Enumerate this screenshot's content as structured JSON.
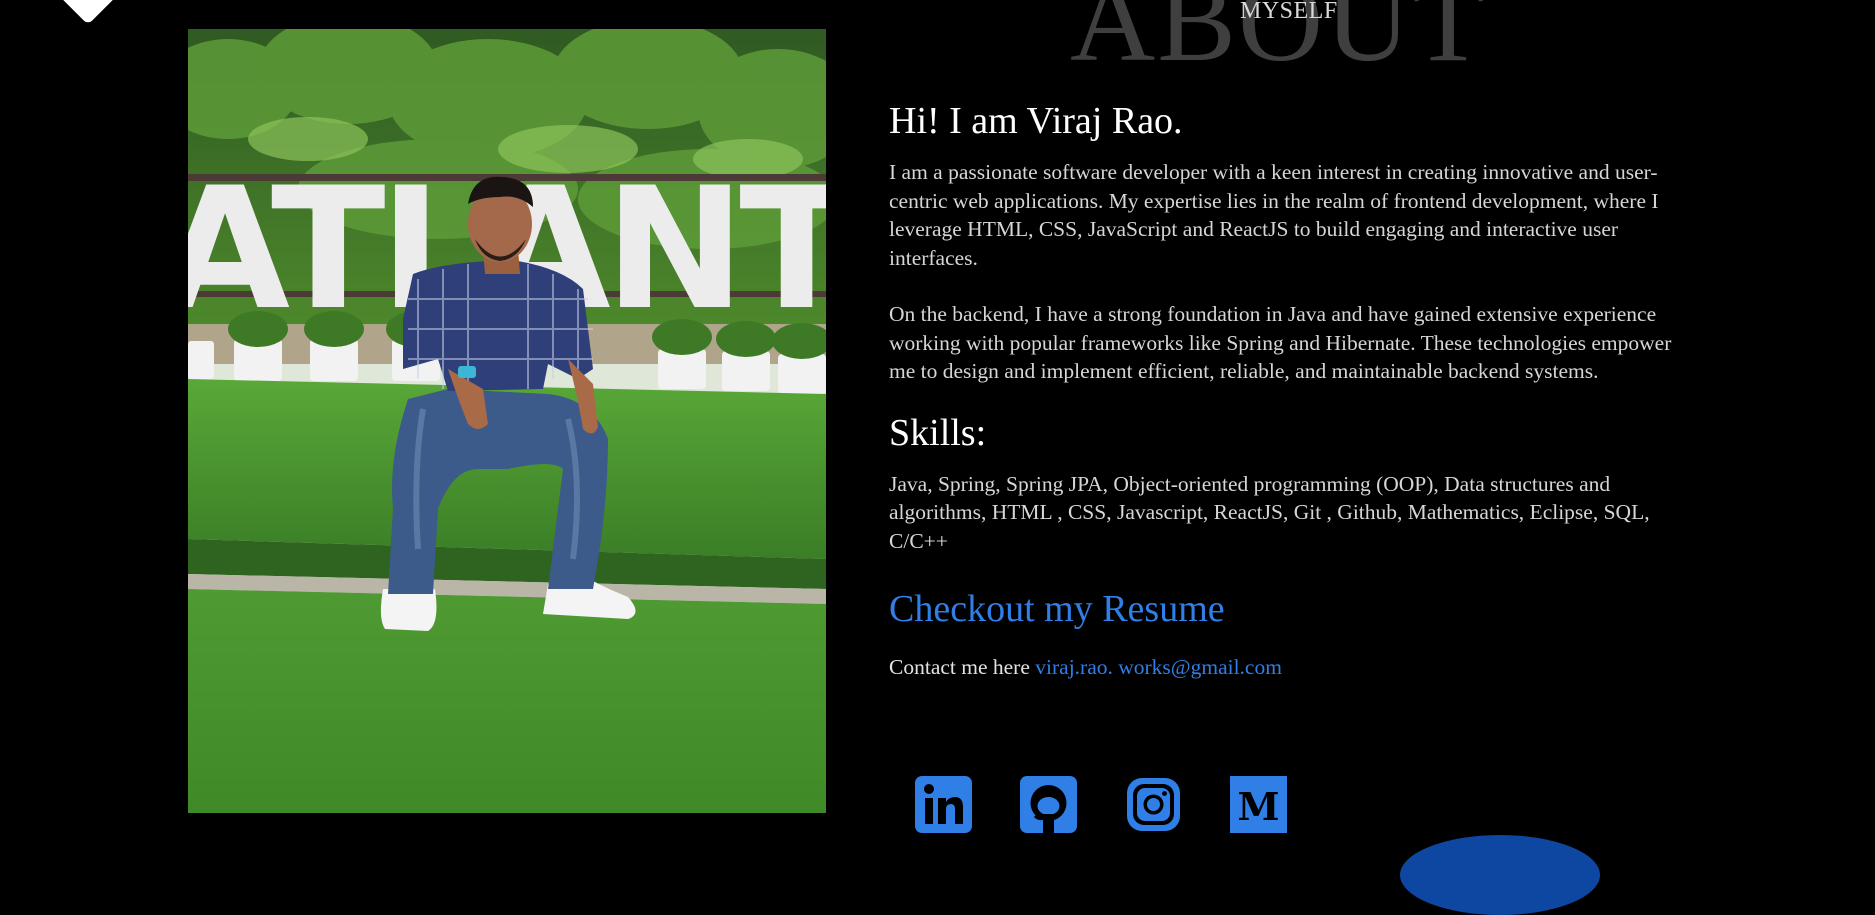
{
  "colors": {
    "background": "#000000",
    "accent": "#2f7fe6",
    "heading_ghost": "#3f3f3f",
    "text_body": "#d6d6d6"
  },
  "section": {
    "background_word": "ABOUT",
    "label": "MYSELF"
  },
  "photo": {
    "sign_text": "ATLANT"
  },
  "about": {
    "greeting": "Hi! I am Viraj Rao.",
    "paragraphs": [
      "I am a passionate software developer with a keen interest in creating innovative and user-centric web applications. My expertise lies in the realm of frontend development, where I leverage HTML, CSS, JavaScript and ReactJS to build engaging and interactive user interfaces.",
      "On the backend, I have a strong foundation in Java and have gained extensive experience working with popular frameworks like Spring and Hibernate. These technologies empower me to design and implement efficient, reliable, and maintainable backend systems."
    ]
  },
  "skills": {
    "heading": "Skills:",
    "list": "Java, Spring, Spring JPA, Object-oriented programming (OOP), Data structures and algorithms, HTML , CSS, Javascript, ReactJS, Git , Github, Mathematics, Eclipse, SQL, C/C++"
  },
  "resume": {
    "label": "Checkout my Resume"
  },
  "contact": {
    "prefix": "Contact me here",
    "email": "viraj.rao. works@gmail.com"
  },
  "social": [
    {
      "icon": "linkedin-icon",
      "glyph": "in"
    },
    {
      "icon": "github-icon"
    },
    {
      "icon": "instagram-icon"
    },
    {
      "icon": "medium-icon",
      "glyph": "M"
    }
  ]
}
